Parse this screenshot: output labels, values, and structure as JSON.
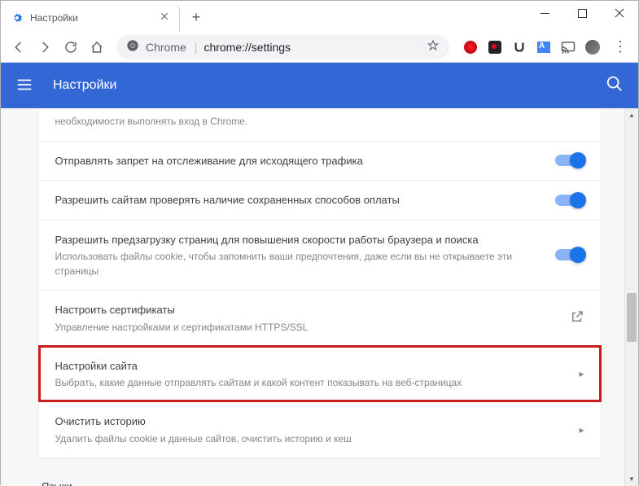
{
  "window": {
    "tab_title": "Настройки",
    "address_scheme": "Chrome",
    "address_path": "chrome://settings"
  },
  "header": {
    "title": "Настройки"
  },
  "settings": {
    "partial_top": "необходимости выполнять вход в Chrome.",
    "dnt": {
      "label": "Отправлять запрет на отслеживание для исходящего трафика"
    },
    "payment": {
      "label": "Разрешить сайтам проверять наличие сохраненных способов оплаты"
    },
    "preload": {
      "label": "Разрешить предзагрузку страниц для повышения скорости работы браузера и поиска",
      "sub": "Использовать файлы cookie, чтобы запомнить ваши предпочтения, даже если вы не открываете эти страницы"
    },
    "certs": {
      "label": "Настроить сертификаты",
      "sub": "Управление настройками и сертификатами HTTPS/SSL"
    },
    "site": {
      "label": "Настройки сайта",
      "sub": "Выбрать, какие данные отправлять сайтам и какой контент показывать на веб-страницах"
    },
    "clear": {
      "label": "Очистить историю",
      "sub": "Удалить файлы cookie и данные сайтов, очистить историю и кеш"
    }
  },
  "section": {
    "languages": "Языки"
  }
}
